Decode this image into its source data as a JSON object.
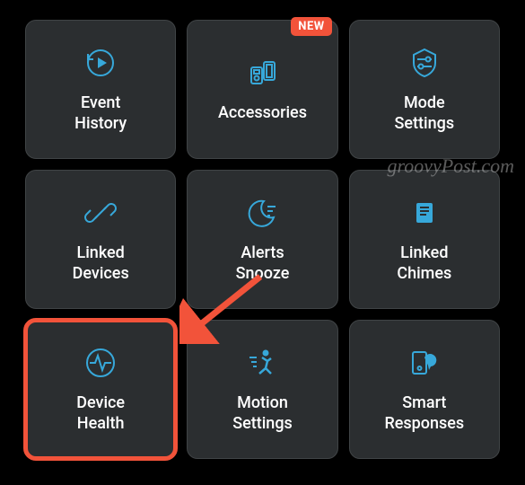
{
  "badge": "NEW",
  "watermark": "groovyPost.com",
  "accent_color": "#37a8da",
  "highlight_color": "#f2533a",
  "tiles": [
    {
      "label": "Event\nHistory",
      "icon": "event-history-icon"
    },
    {
      "label": "Accessories",
      "icon": "accessories-icon",
      "badge": true
    },
    {
      "label": "Mode\nSettings",
      "icon": "mode-settings-icon"
    },
    {
      "label": "Linked\nDevices",
      "icon": "linked-devices-icon"
    },
    {
      "label": "Alerts\nSnooze",
      "icon": "alerts-snooze-icon"
    },
    {
      "label": "Linked\nChimes",
      "icon": "linked-chimes-icon"
    },
    {
      "label": "Device\nHealth",
      "icon": "device-health-icon",
      "highlighted": true
    },
    {
      "label": "Motion\nSettings",
      "icon": "motion-settings-icon"
    },
    {
      "label": "Smart\nResponses",
      "icon": "smart-responses-icon"
    }
  ]
}
